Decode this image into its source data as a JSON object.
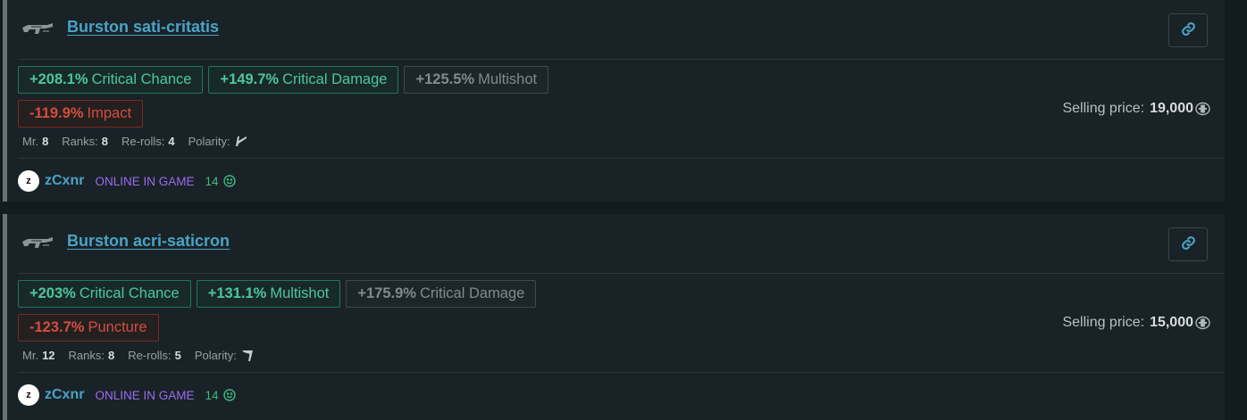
{
  "listings": [
    {
      "title": "Burston sati-critatis",
      "weapon_icon": "burston-rifle-icon",
      "positive_stats": [
        {
          "value": "+208.1%",
          "name": "Critical Chance"
        },
        {
          "value": "+149.7%",
          "name": "Critical Damage"
        }
      ],
      "neutral_stats": [
        {
          "value": "+125.5%",
          "name": "Multishot"
        }
      ],
      "negative_stat": {
        "value": "-119.9%",
        "name": "Impact"
      },
      "mr_label": "Mr.",
      "mr": "8",
      "ranks_label": "Ranks:",
      "ranks": "8",
      "rerolls_label": "Re-rolls:",
      "rerolls": "4",
      "polarity_label": "Polarity:",
      "polarity_icon": "naramon-polarity-icon",
      "seller": {
        "avatar_letter": "z",
        "name": "zCxnr",
        "status": "ONLINE IN GAME",
        "reputation": "14",
        "reputation_icon": "smiley-icon"
      },
      "price_label": "Selling price:",
      "price": "19,000",
      "price_icon": "platinum-icon"
    },
    {
      "title": "Burston acri-saticron",
      "weapon_icon": "burston-rifle-icon",
      "positive_stats": [
        {
          "value": "+203%",
          "name": "Critical Chance"
        },
        {
          "value": "+131.1%",
          "name": "Multishot"
        }
      ],
      "neutral_stats": [
        {
          "value": "+175.9%",
          "name": "Critical Damage"
        }
      ],
      "negative_stat": {
        "value": "-123.7%",
        "name": "Puncture"
      },
      "mr_label": "Mr.",
      "mr": "12",
      "ranks_label": "Ranks:",
      "ranks": "8",
      "rerolls_label": "Re-rolls:",
      "rerolls": "5",
      "polarity_label": "Polarity:",
      "polarity_icon": "vazarin-polarity-icon",
      "seller": {
        "avatar_letter": "z",
        "name": "zCxnr",
        "status": "ONLINE IN GAME",
        "reputation": "14",
        "reputation_icon": "smiley-icon"
      },
      "price_label": "Selling price:",
      "price": "15,000",
      "price_icon": "platinum-icon"
    }
  ],
  "colors": {
    "title_link": "#4aa3c7",
    "positive_stat": "#4ec69c",
    "negative_stat": "#d44d40",
    "neutral_stat": "#818a8e",
    "online_status": "#9b6cf0",
    "reputation": "#3fb980"
  }
}
